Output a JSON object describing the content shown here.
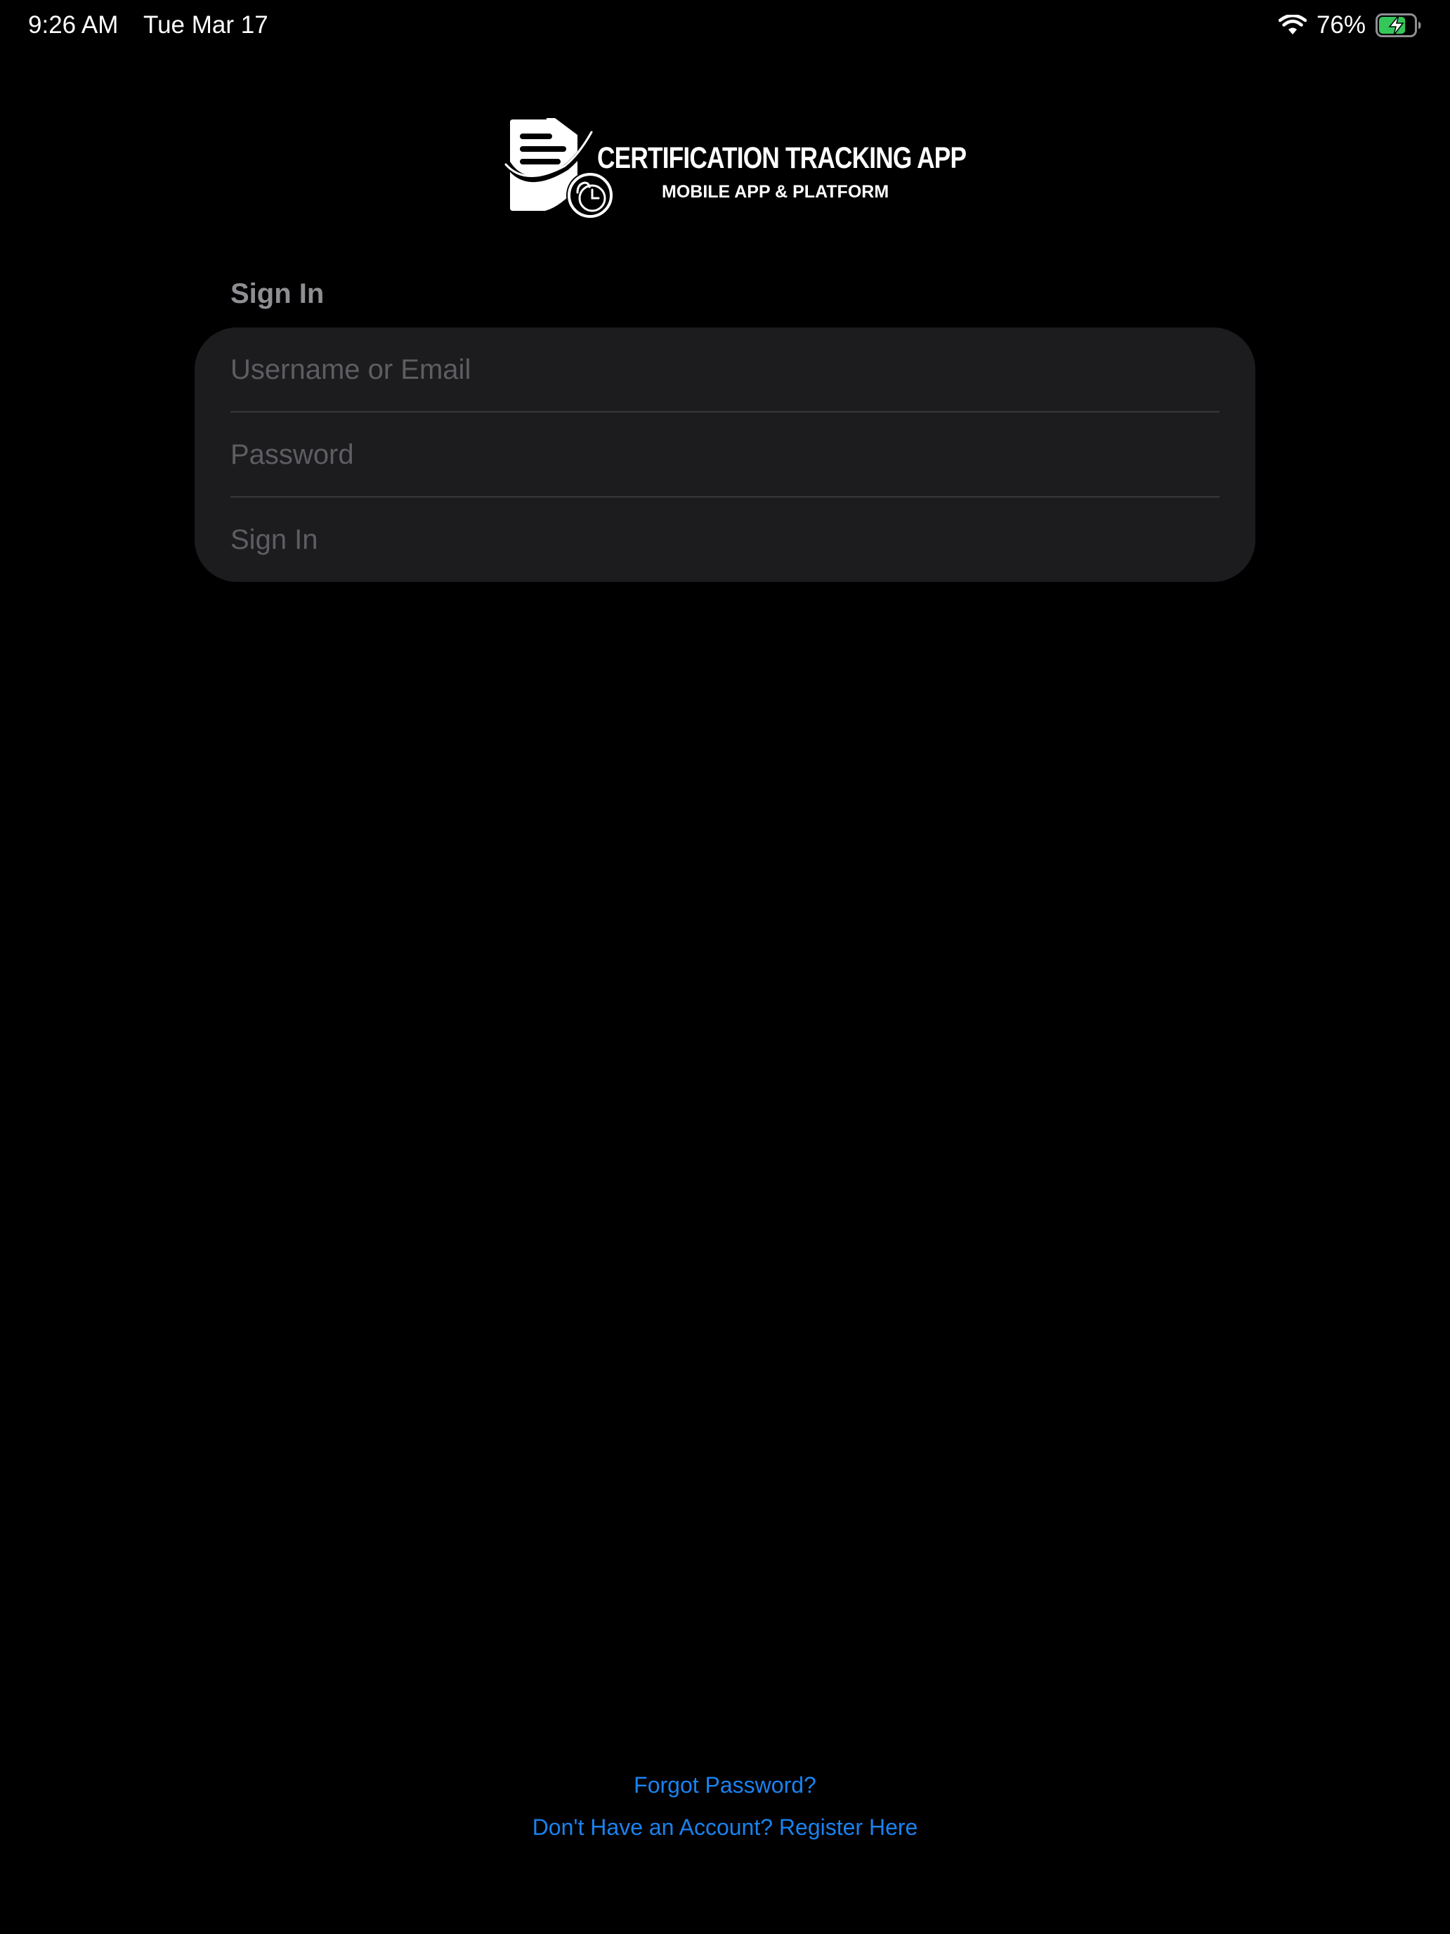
{
  "status_bar": {
    "time": "9:26 AM",
    "date": "Tue Mar 17",
    "battery_percent": "76%",
    "battery_level": 0.76,
    "battery_charging": true,
    "wifi_icon": "wifi-icon",
    "battery_icon": "battery-charging-icon"
  },
  "logo": {
    "title": "CERTIFICATION TRACKING APP",
    "subtitle": "MOBILE APP & PLATFORM",
    "icon": "certificate-clock-icon"
  },
  "sign_in": {
    "header": "Sign In",
    "username_placeholder": "Username or Email",
    "password_placeholder": "Password",
    "button_label": "Sign In"
  },
  "footer": {
    "forgot_password": "Forgot Password?",
    "register": "Don't Have an Account? Register Here"
  },
  "colors": {
    "background": "#000000",
    "card": "#1c1c1e",
    "link": "#1a82f0",
    "placeholder": "#5d5d62",
    "header": "#8e8e93",
    "battery_green": "#34c759"
  }
}
